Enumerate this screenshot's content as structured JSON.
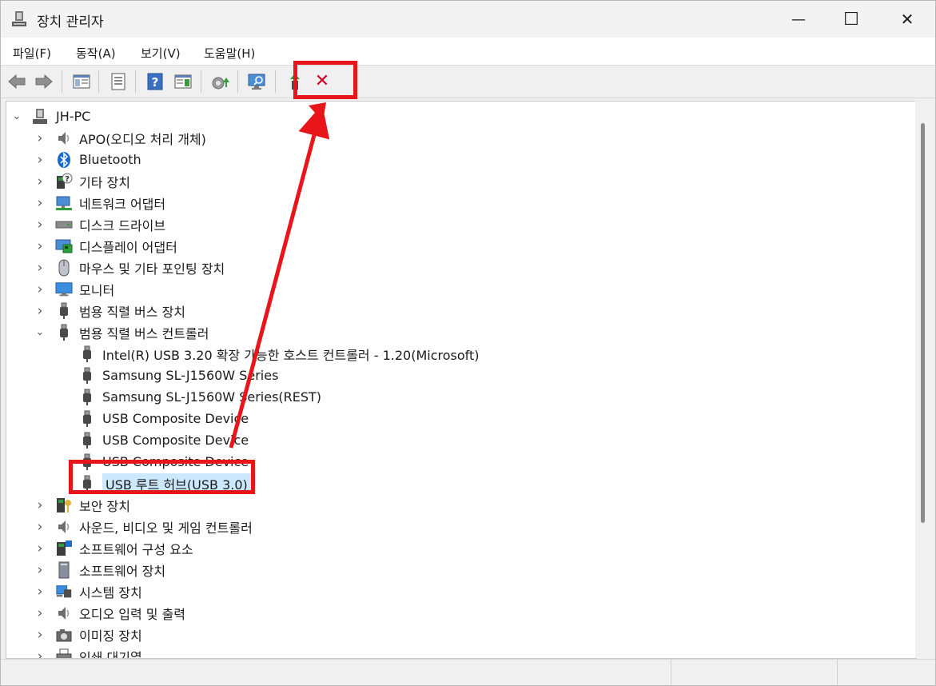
{
  "window": {
    "title": "장치 관리자",
    "minimize_glyph": "—",
    "maximize_glyph": "☐",
    "close_glyph": "✕"
  },
  "menu": [
    {
      "label": "파일(F)"
    },
    {
      "label": "동작(A)"
    },
    {
      "label": "보기(V)"
    },
    {
      "label": "도움말(H)"
    }
  ],
  "toolbar": {
    "uninstall_glyph": "✕",
    "uninstall_color": "#d0021b"
  },
  "tree": {
    "root": "JH-PC",
    "categories": [
      {
        "label": "APO(오디오 처리 개체)",
        "icon": "speaker-icon"
      },
      {
        "label": "Bluetooth",
        "icon": "bluetooth-icon"
      },
      {
        "label": "기타 장치",
        "icon": "unknown-device-icon"
      },
      {
        "label": "네트워크 어댑터",
        "icon": "network-icon"
      },
      {
        "label": "디스크 드라이브",
        "icon": "disk-icon"
      },
      {
        "label": "디스플레이 어댑터",
        "icon": "display-adapter-icon"
      },
      {
        "label": "마우스 및 기타 포인팅 장치",
        "icon": "mouse-icon"
      },
      {
        "label": "모니터",
        "icon": "monitor-icon"
      },
      {
        "label": "범용 직렬 버스 장치",
        "icon": "usb-icon"
      },
      {
        "label": "범용 직렬 버스 컨트롤러",
        "icon": "usb-icon",
        "expanded": true
      }
    ],
    "usb_children": [
      "Intel(R) USB 3.20 확장 가능한 호스트 컨트롤러 - 1.20(Microsoft)",
      "Samsung SL-J1560W Series",
      "Samsung SL-J1560W Series(REST)",
      "USB Composite Device",
      "USB Composite Device",
      "USB Composite Device",
      "USB 루트 허브(USB 3.0)"
    ],
    "selected_child": "USB 루트 허브(USB 3.0)",
    "categories_after": [
      {
        "label": "보안 장치",
        "icon": "security-icon"
      },
      {
        "label": "사운드, 비디오 및 게임 컨트롤러",
        "icon": "speaker-icon"
      },
      {
        "label": "소프트웨어 구성 요소",
        "icon": "software-component-icon"
      },
      {
        "label": "소프트웨어 장치",
        "icon": "software-device-icon"
      },
      {
        "label": "시스템 장치",
        "icon": "system-icon"
      },
      {
        "label": "오디오 입력 및 출력",
        "icon": "speaker-icon"
      },
      {
        "label": "이미징 장치",
        "icon": "camera-icon"
      },
      {
        "label": "인쇄 대기열",
        "icon": "printer-icon"
      }
    ]
  },
  "annotation": {
    "color": "#e8151b"
  }
}
